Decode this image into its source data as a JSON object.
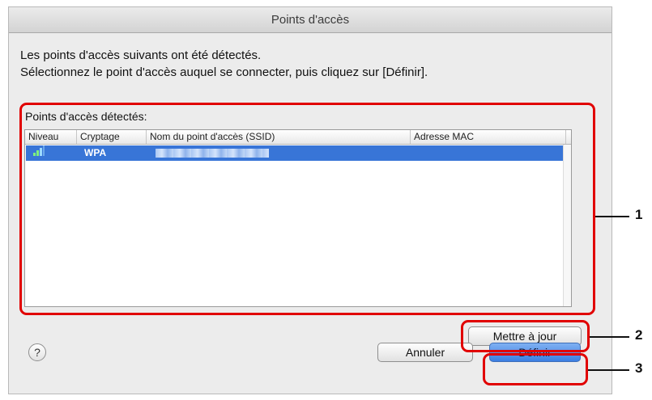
{
  "window": {
    "title": "Points d'accès"
  },
  "instructions": {
    "line1": "Les points d'accès suivants ont été détectés.",
    "line2": "Sélectionnez le point d'accès auquel se connecter, puis cliquez sur [Définir]."
  },
  "list_group": {
    "label": "Points d'accès détectés:"
  },
  "table": {
    "columns": [
      "Niveau",
      "Cryptage",
      "Nom du point d'accès (SSID)",
      "Adresse MAC"
    ],
    "rows": [
      {
        "level_icon": "signal-strength-icon",
        "encryption": "WPA",
        "ssid": "",
        "mac": ""
      }
    ]
  },
  "buttons": {
    "refresh": "Mettre à jour",
    "cancel": "Annuler",
    "set": "Définir",
    "help": "?"
  },
  "callouts": [
    "1",
    "2",
    "3"
  ],
  "colors": {
    "highlight": "#e10000",
    "selection": "#3875d7"
  }
}
